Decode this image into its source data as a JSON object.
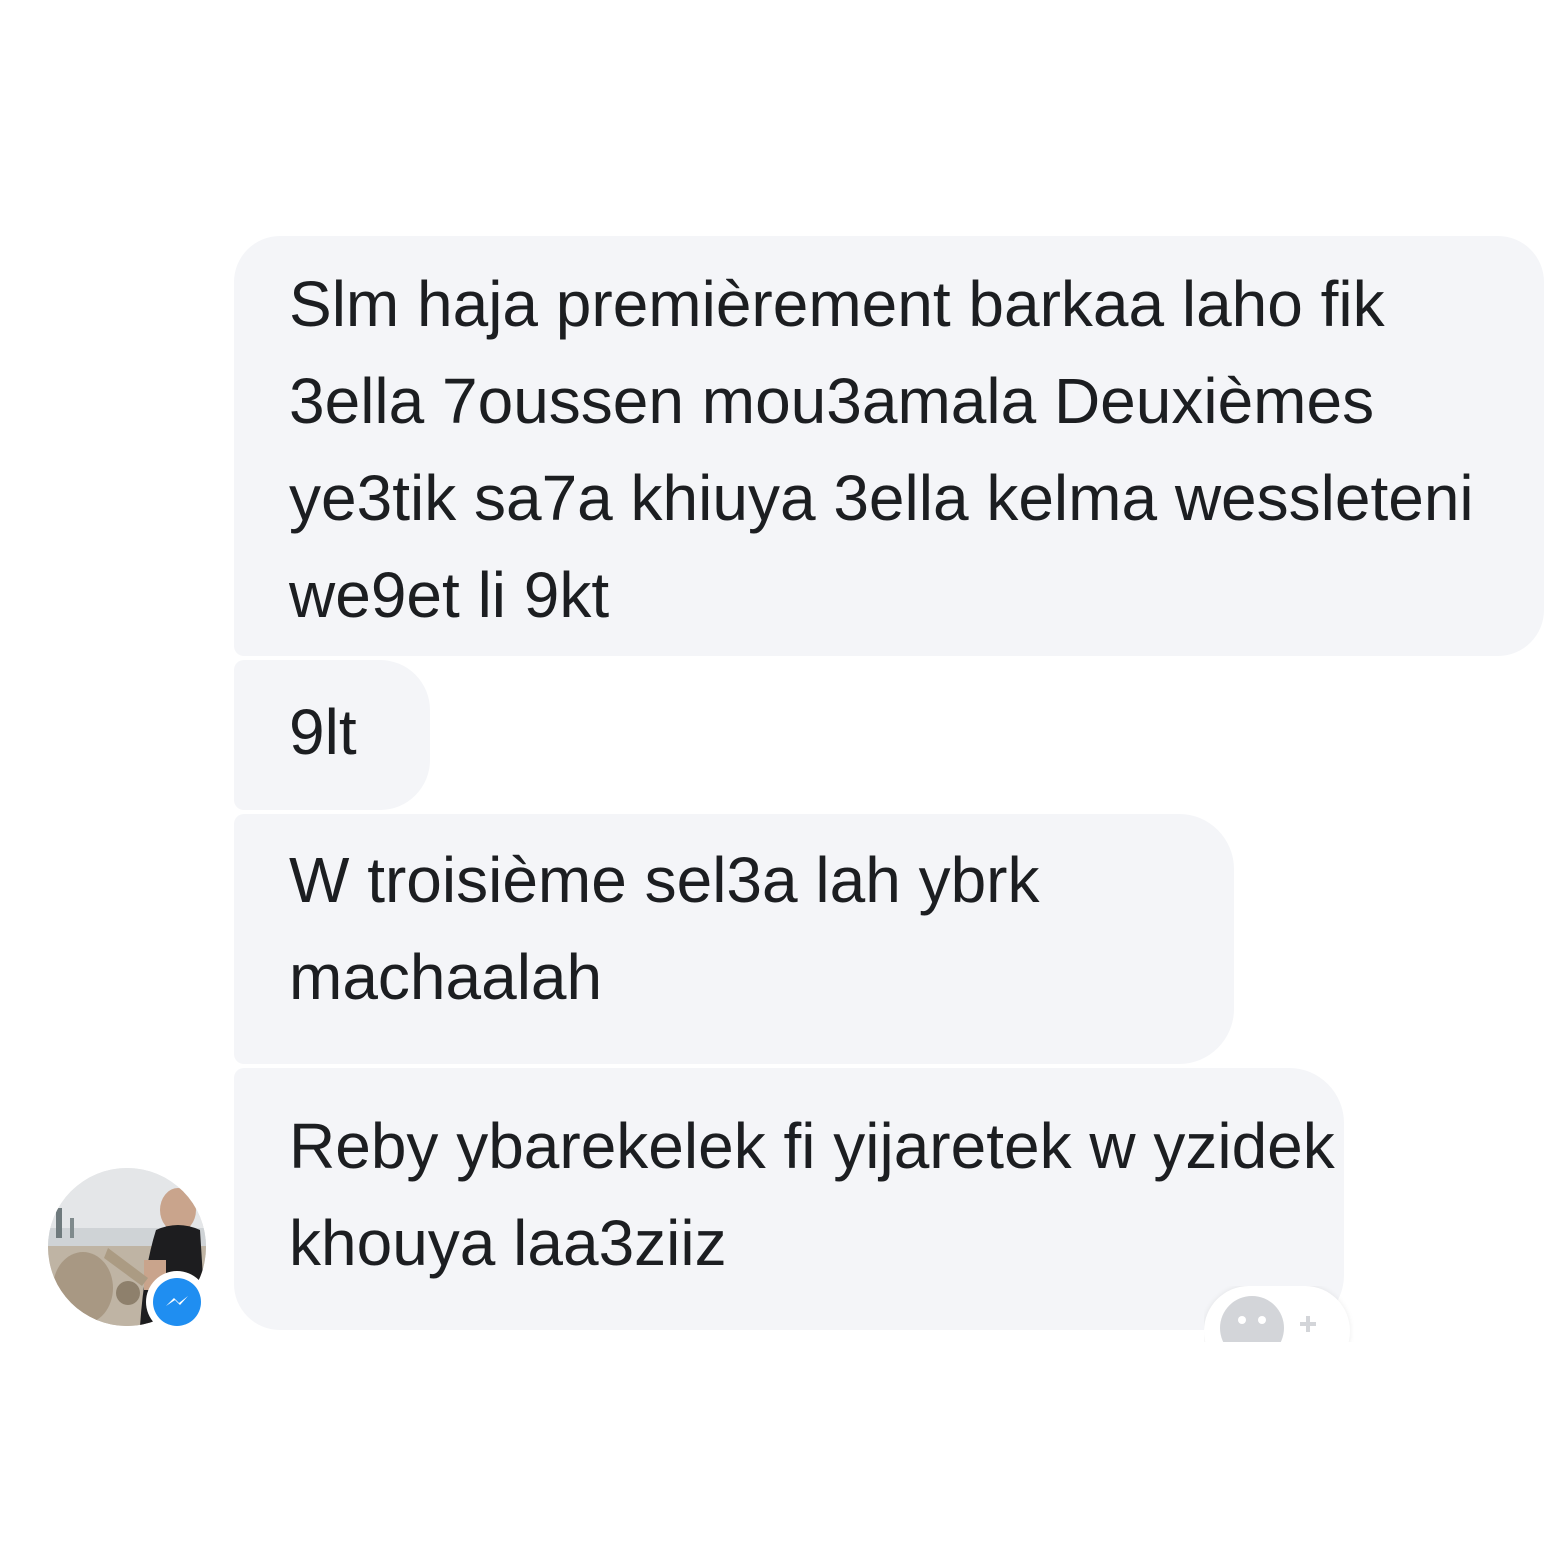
{
  "conversation": {
    "messages": [
      {
        "sender": "other",
        "text": "Slm haja premièrement barkaa laho fik 3ella 7oussen mou3amala Deuxièmes ye3tik sa7a khiuya 3ella kelma wessleteni we9et li 9kt"
      },
      {
        "sender": "other",
        "text": "9lt"
      },
      {
        "sender": "other",
        "text": "W troisième sel3a lah ybrk machaalah"
      },
      {
        "sender": "other",
        "text": "Reby ybarekelek fi yijaretek w yzidek khouya laa3ziiz"
      }
    ],
    "avatar_icon": "user-avatar",
    "badge_icon": "messenger-icon",
    "reaction_icon": "add-reaction-icon"
  },
  "colors": {
    "bubble_bg": "#f4f5f8",
    "text": "#1c1e21",
    "messenger_blue": "#1f8ef1",
    "reaction_gray": "#d3d5d9"
  }
}
